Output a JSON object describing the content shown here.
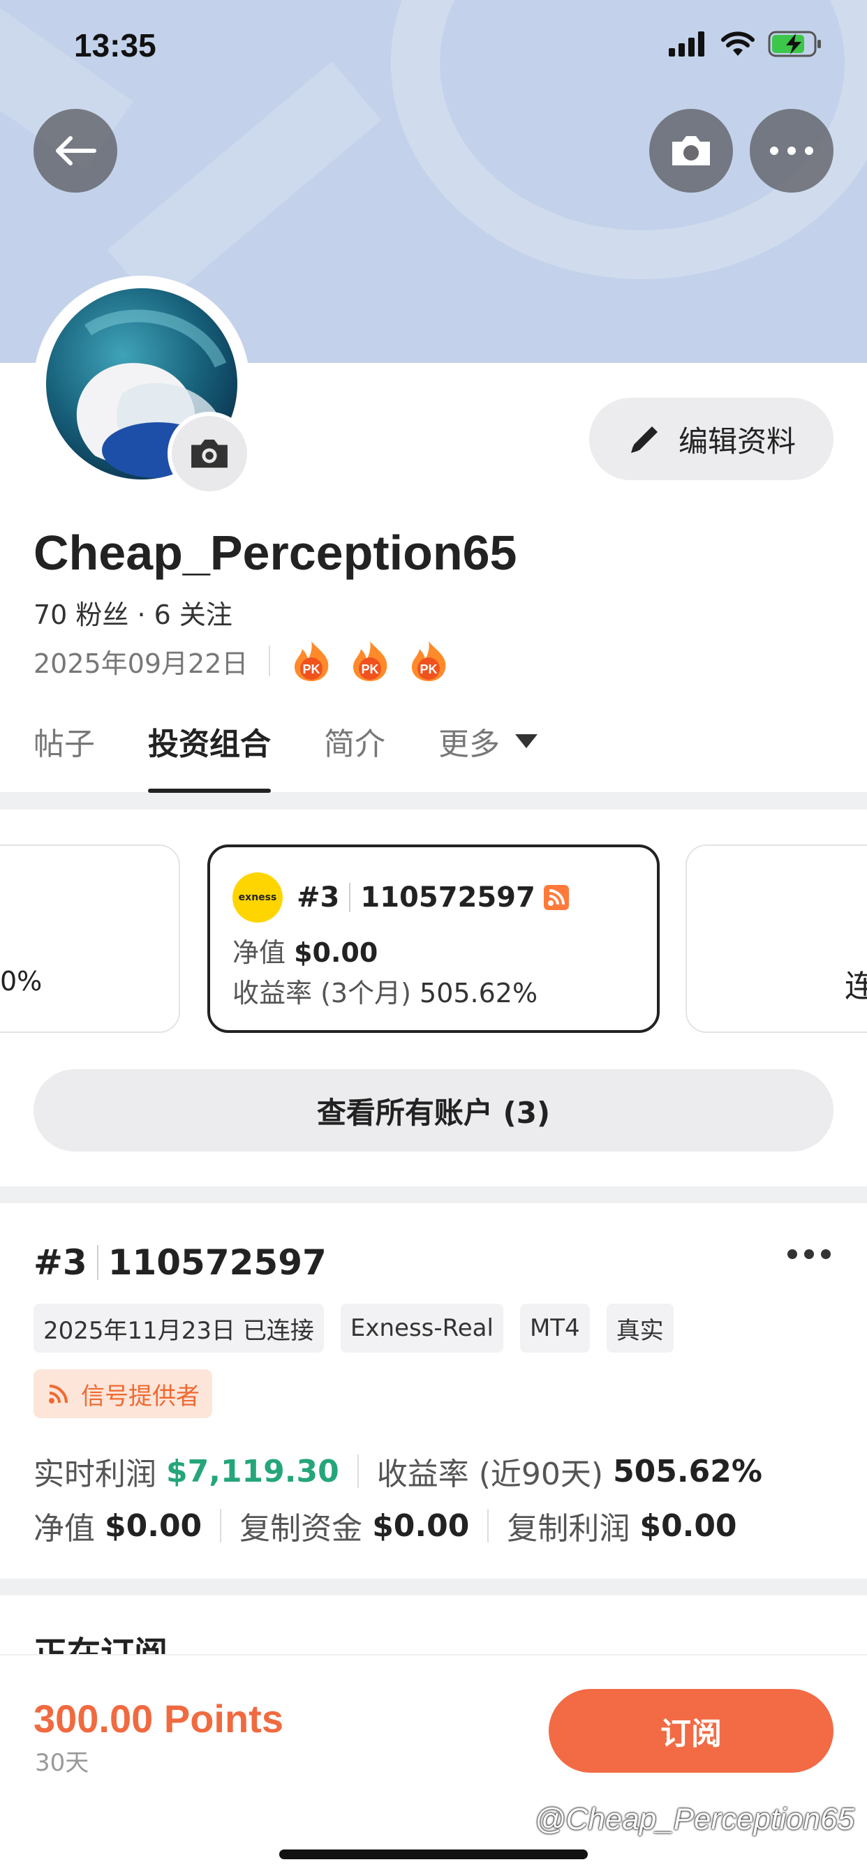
{
  "status": {
    "time": "13:35"
  },
  "profile": {
    "name": "Cheap_Perception65",
    "follow_text": "70 粉丝 · 6 关注",
    "joined": "2025年09月22日",
    "badge_text": "PK",
    "edit_label": "编辑资料"
  },
  "tabs": [
    {
      "label": "帖子"
    },
    {
      "label": "投资组合"
    },
    {
      "label": "简介"
    },
    {
      "label": "更多"
    }
  ],
  "carousel": {
    "left_peek_text": "0%",
    "right_peek_text": "连",
    "active": {
      "broker_logo_text": "exness",
      "index": "#3",
      "account": "110572597",
      "equity_label": "净值",
      "equity_value": "$0.00",
      "return_label": "收益率 (3个月)",
      "return_value": "505.62%"
    }
  },
  "view_all_label": "查看所有账户 (3)",
  "account": {
    "index": "#3",
    "number": "110572597",
    "chips": [
      "2025年11月23日 已连接",
      "Exness-Real",
      "MT4",
      "真实"
    ],
    "signal_label": "信号提供者",
    "realtime_profit_label": "实时利润",
    "realtime_profit_value": "$7,119.30",
    "return_label": "收益率 (近90天)",
    "return_value": "505.62%",
    "equity_label": "净值",
    "equity_value": "$0.00",
    "copy_funds_label": "复制资金",
    "copy_funds_value": "$0.00",
    "copy_profit_label": "复制利润",
    "copy_profit_value": "$0.00"
  },
  "next_section_title": "正在订阅",
  "bottom": {
    "price": "300.00 Points",
    "period": "30天",
    "subscribe_label": "订阅",
    "watermark": "@Cheap_Perception65"
  },
  "colors": {
    "accent": "#f26b44",
    "profit_green": "#25a57a",
    "banner": "#c3d2ea"
  }
}
